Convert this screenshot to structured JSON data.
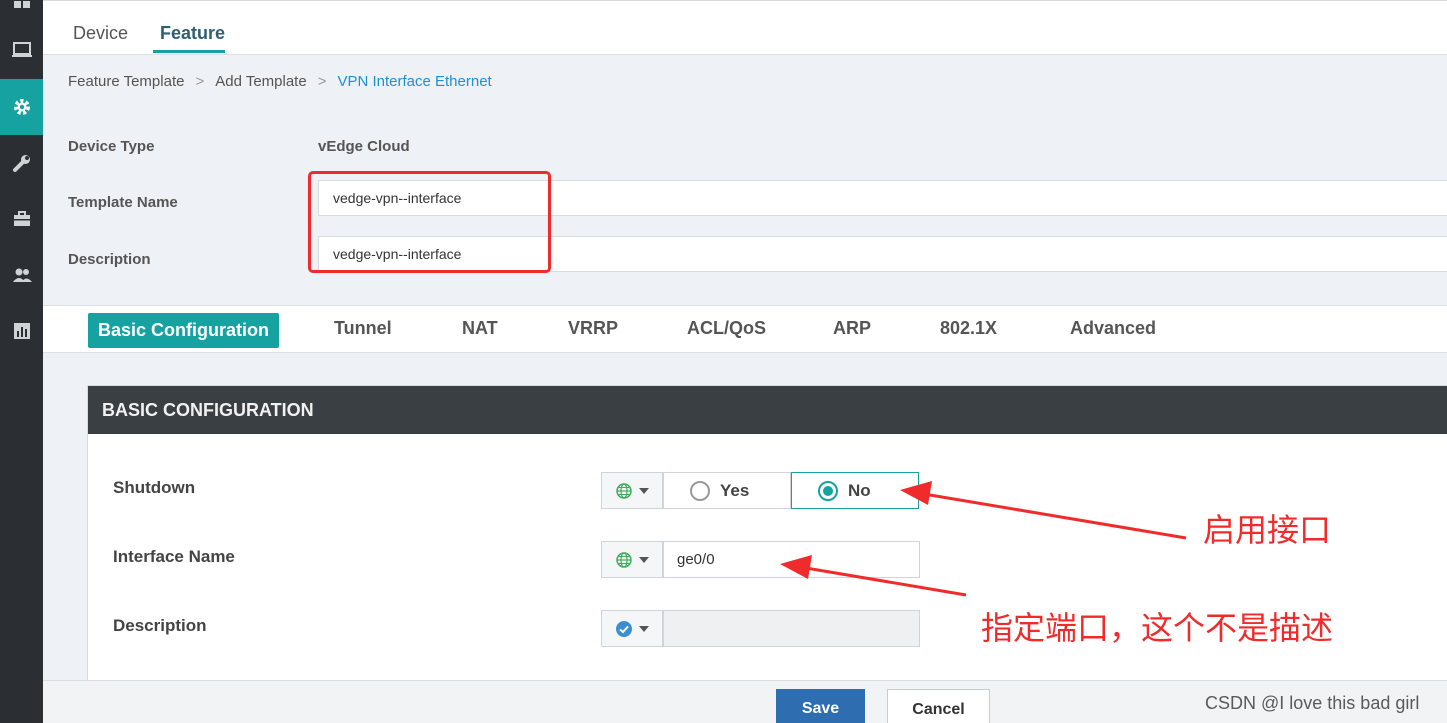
{
  "sidebar": {
    "items": [
      {
        "icon": "dashboard-icon",
        "active": false
      },
      {
        "icon": "monitor-icon",
        "active": false
      },
      {
        "icon": "gear-icon",
        "active": true
      },
      {
        "icon": "wrench-icon",
        "active": false
      },
      {
        "icon": "briefcase-icon",
        "active": false
      },
      {
        "icon": "users-icon",
        "active": false
      },
      {
        "icon": "bar-chart-icon",
        "active": false
      }
    ]
  },
  "top_tabs": {
    "device": "Device",
    "feature": "Feature"
  },
  "breadcrumb": {
    "items": [
      "Feature Template",
      "Add Template",
      "VPN Interface Ethernet"
    ],
    "separator": ">"
  },
  "form": {
    "device_type_label": "Device Type",
    "device_type_value": "vEdge Cloud",
    "template_name_label": "Template Name",
    "template_name_value": "vedge-vpn--interface",
    "description_label": "Description",
    "description_value": "vedge-vpn--interface"
  },
  "section_tabs": [
    "Basic Configuration",
    "Tunnel",
    "NAT",
    "VRRP",
    "ACL/QoS",
    "ARP",
    "802.1X",
    "Advanced"
  ],
  "basic_config": {
    "header": "BASIC CONFIGURATION",
    "shutdown_label": "Shutdown",
    "shutdown_yes": "Yes",
    "shutdown_no": "No",
    "shutdown_selected": "No",
    "interface_name_label": "Interface Name",
    "interface_name_value": "ge0/0",
    "description_label": "Description",
    "description_value": ""
  },
  "footer": {
    "save": "Save",
    "cancel": "Cancel"
  },
  "annotations": {
    "enable_interface": "启用接口",
    "port_note": "指定端口，这个不是描述"
  },
  "watermark": "CSDN @I love this bad girl",
  "colors": {
    "accent": "#17a2a2",
    "sidebar": "#2b2f33",
    "annotation": "#ef2b2b",
    "save_button": "#2e6eb0"
  }
}
